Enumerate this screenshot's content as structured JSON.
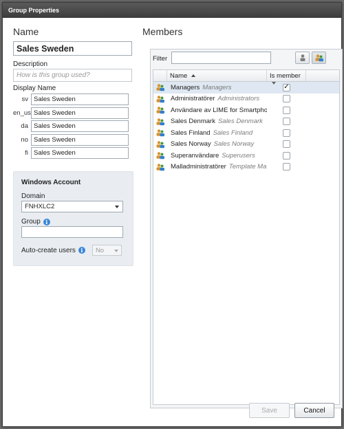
{
  "window": {
    "title": "Group Properties"
  },
  "left": {
    "heading": "Name",
    "name_value": "Sales Sweden",
    "description_label": "Description",
    "description_placeholder": "How is this group used?",
    "display_name_label": "Display Name",
    "display_names": [
      {
        "code": "sv",
        "value": "Sales Sweden"
      },
      {
        "code": "en_us",
        "value": "Sales Sweden"
      },
      {
        "code": "da",
        "value": "Sales Sweden"
      },
      {
        "code": "no",
        "value": "Sales Sweden"
      },
      {
        "code": "fi",
        "value": "Sales Sweden"
      }
    ],
    "windows_account": {
      "heading": "Windows Account",
      "domain_label": "Domain",
      "domain_value": "FNHXLC2",
      "group_label": "Group",
      "group_value": "",
      "auto_create_label": "Auto-create users",
      "auto_create_value": "No"
    }
  },
  "right": {
    "heading": "Members",
    "filter_label": "Filter",
    "filter_value": "",
    "columns": {
      "name": "Name",
      "is_member": "Is member"
    },
    "rows": [
      {
        "name": "Managers",
        "en": "Managers",
        "checked": true,
        "selected": true
      },
      {
        "name": "Administratörer",
        "en": "Administrators",
        "checked": false
      },
      {
        "name": "Användare av LIME for Smartphor",
        "en": "",
        "checked": false
      },
      {
        "name": "Sales Denmark",
        "en": "Sales Denmark",
        "checked": false
      },
      {
        "name": "Sales Finland",
        "en": "Sales Finland",
        "checked": false
      },
      {
        "name": "Sales Norway",
        "en": "Sales Norway",
        "checked": false
      },
      {
        "name": "Superanvändare",
        "en": "Superusers",
        "checked": false
      },
      {
        "name": "Malladministratörer",
        "en": "Template Ma",
        "checked": false
      }
    ]
  },
  "footer": {
    "save_label": "Save",
    "cancel_label": "Cancel"
  },
  "colors": {
    "titlebar": "#3c3c3c",
    "panel": "#e9edf1",
    "info_blue": "#3a86d6",
    "selected_row": "#dfe8f2"
  }
}
